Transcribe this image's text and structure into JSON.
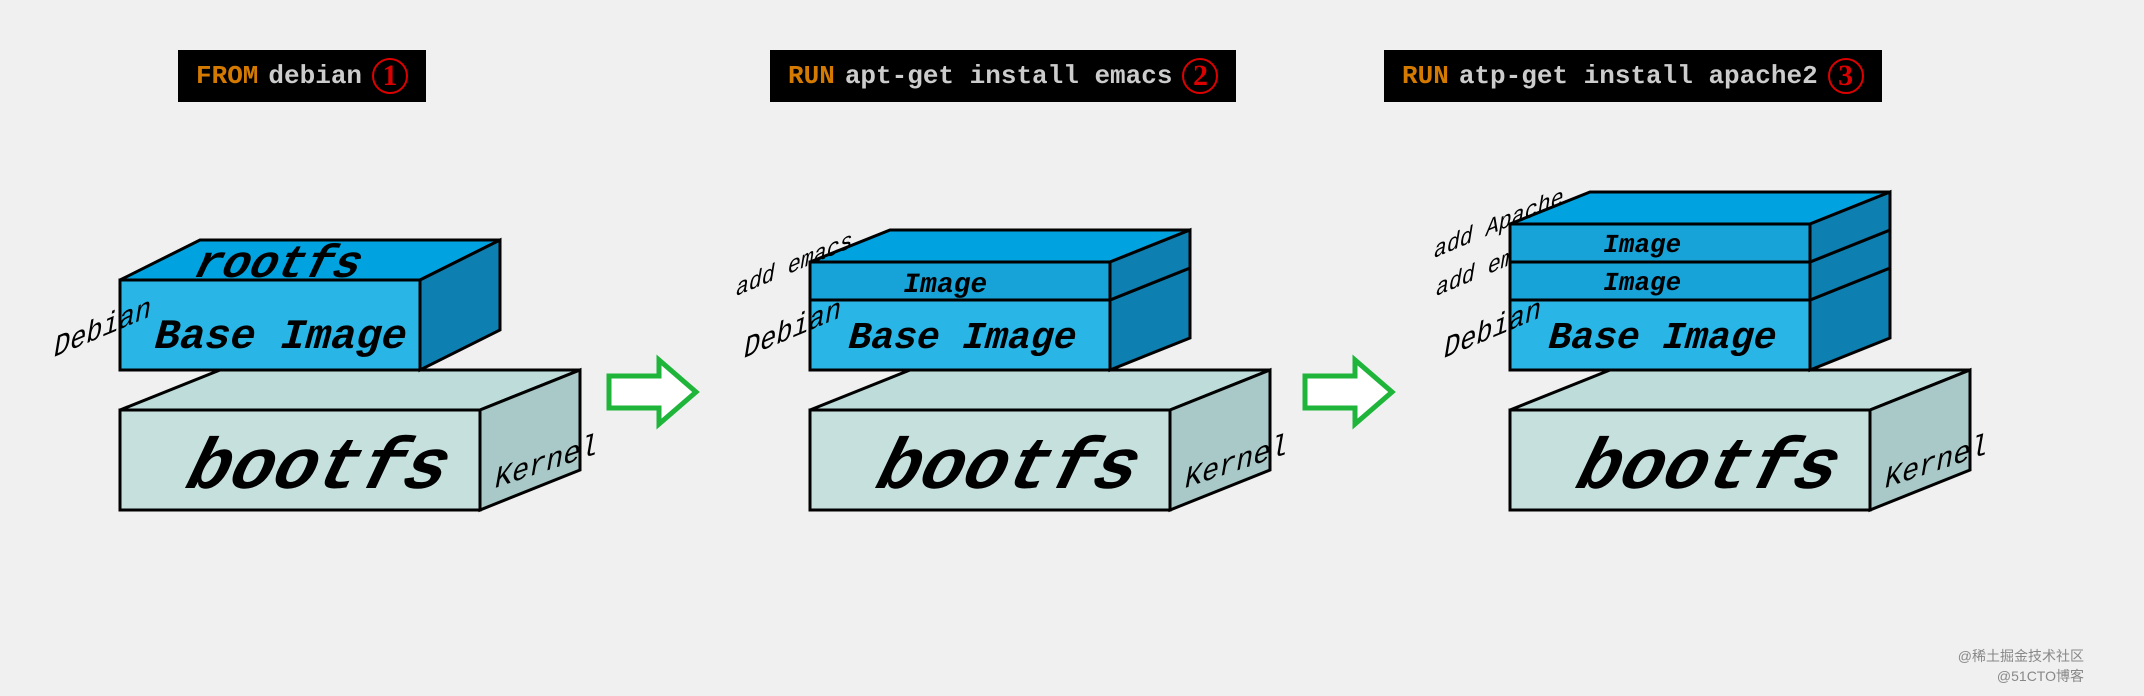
{
  "commands": [
    {
      "keyword": "FROM",
      "args": "debian",
      "num": "1"
    },
    {
      "keyword": "RUN",
      "args": "apt-get install emacs",
      "num": "2"
    },
    {
      "keyword": "RUN",
      "args": "atp-get install apache2",
      "num": "3"
    }
  ],
  "labels": {
    "rootfs": "rootfs",
    "bootfs": "bootfs",
    "kernel": "Kernel",
    "debian": "Debian",
    "base_image": "Base Image",
    "image": "Image",
    "add_emacs": "add emacs",
    "add_apache": "add Apache"
  },
  "watermarks": {
    "w1": "@稀土掘金技术社区",
    "w2": "@51CTO博客"
  }
}
